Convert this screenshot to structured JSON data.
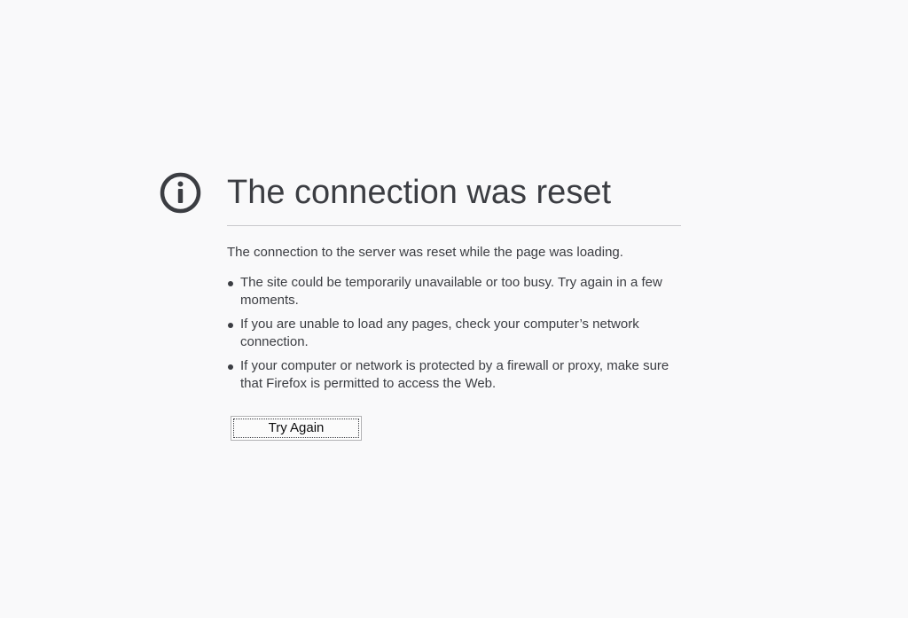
{
  "error_page": {
    "icon": "info-icon",
    "title": "The connection was reset",
    "description": "The connection to the server was reset while the page was loading.",
    "suggestions": [
      "The site could be temporarily unavailable or too busy. Try again in a few moments.",
      "If you are unable to load any pages, check your computer’s network connection.",
      "If your computer or network is protected by a firewall or proxy, make sure that Firefox is permitted to access the Web."
    ],
    "try_again_label": "Try Again"
  },
  "colors": {
    "background": "#f9f9fa",
    "text": "#3b3d42",
    "divider": "#c8c8cc"
  }
}
